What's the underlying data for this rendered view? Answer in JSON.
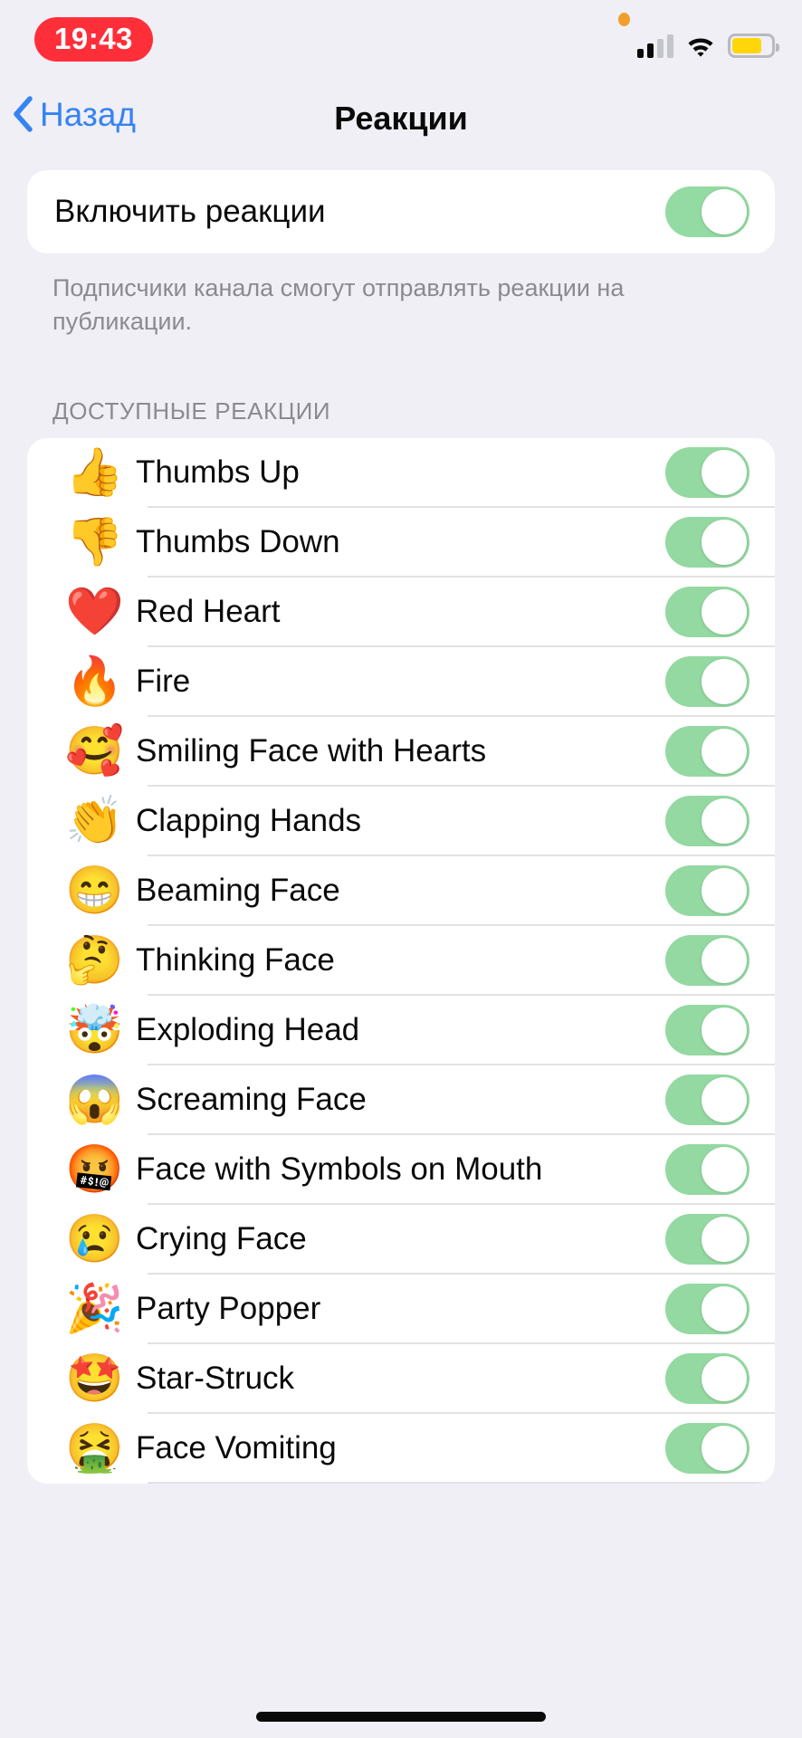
{
  "status_bar": {
    "time": "19:43",
    "privacy_indicator": "orange-recording-dot",
    "cellular_bars_filled": 2,
    "cellular_bars_total": 4,
    "wifi": "wifi-icon",
    "battery_level_percent": 75,
    "battery_color": "#FFD60A"
  },
  "nav": {
    "back_label": "Назад",
    "title": "Реакции"
  },
  "main_setting": {
    "label": "Включить реакции",
    "enabled": true,
    "footer": "Подписчики канала смогут отправлять реакции на публикации."
  },
  "section": {
    "header": "ДОСТУПНЫЕ РЕАКЦИИ"
  },
  "colors": {
    "background": "#F0EFF5",
    "card": "#FFFFFF",
    "accent_blue": "#3683F2",
    "toggle_on_green": "#93DBA2",
    "time_pill_red": "#FF2F3A",
    "secondary_text": "#8A8A90",
    "separator": "#E2E2E6"
  },
  "reactions": [
    {
      "emoji": "👍",
      "icon": "thumbs-up-emoji",
      "label": "Thumbs Up",
      "enabled": true
    },
    {
      "emoji": "👎",
      "icon": "thumbs-down-emoji",
      "label": "Thumbs Down",
      "enabled": true
    },
    {
      "emoji": "❤️",
      "icon": "red-heart-emoji",
      "label": "Red Heart",
      "enabled": true
    },
    {
      "emoji": "🔥",
      "icon": "fire-emoji",
      "label": "Fire",
      "enabled": true
    },
    {
      "emoji": "🥰",
      "icon": "smiling-face-with-hearts-emoji",
      "label": "Smiling Face with Hearts",
      "enabled": true
    },
    {
      "emoji": "👏",
      "icon": "clapping-hands-emoji",
      "label": "Clapping Hands",
      "enabled": true
    },
    {
      "emoji": "😁",
      "icon": "beaming-face-emoji",
      "label": "Beaming Face",
      "enabled": true
    },
    {
      "emoji": "🤔",
      "icon": "thinking-face-emoji",
      "label": "Thinking Face",
      "enabled": true
    },
    {
      "emoji": "🤯",
      "icon": "exploding-head-emoji",
      "label": "Exploding Head",
      "enabled": true
    },
    {
      "emoji": "😱",
      "icon": "screaming-face-emoji",
      "label": "Screaming Face",
      "enabled": true
    },
    {
      "emoji": "🤬",
      "icon": "face-with-symbols-on-mouth-emoji",
      "label": "Face with Symbols on Mouth",
      "enabled": true
    },
    {
      "emoji": "😢",
      "icon": "crying-face-emoji",
      "label": "Crying Face",
      "enabled": true
    },
    {
      "emoji": "🎉",
      "icon": "party-popper-emoji",
      "label": "Party Popper",
      "enabled": true
    },
    {
      "emoji": "🤩",
      "icon": "star-struck-emoji",
      "label": "Star-Struck",
      "enabled": true
    },
    {
      "emoji": "🤮",
      "icon": "face-vomiting-emoji",
      "label": "Face Vomiting",
      "enabled": true
    }
  ]
}
